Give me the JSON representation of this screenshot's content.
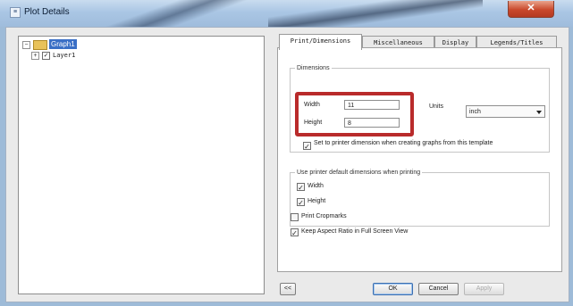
{
  "window": {
    "title": "Plot Details",
    "icon_text": "≡",
    "close_label": "✕"
  },
  "tree": {
    "root": {
      "label": "Graph1",
      "expander": "−"
    },
    "child": {
      "label": "Layer1",
      "expander": "+",
      "checked": "✓"
    }
  },
  "tabs": [
    {
      "label": "Print/Dimensions"
    },
    {
      "label": "Miscellaneous"
    },
    {
      "label": "Display"
    },
    {
      "label": "Legends/Titles"
    }
  ],
  "dimensions": {
    "group_title": "Dimensions",
    "width_label": "Width",
    "width_value": "11",
    "height_label": "Height",
    "height_value": "8",
    "units_label": "Units",
    "units_value": "inch",
    "set_printer_label": "Set to printer dimension when creating graphs from this template",
    "set_printer_checked": "✓"
  },
  "printer_defaults": {
    "group_title": "Use printer default dimensions when printing",
    "width_label": "Width",
    "width_checked": "✓",
    "height_label": "Height",
    "height_checked": "✓"
  },
  "options": {
    "crop_label": "Print Cropmarks",
    "crop_checked": "",
    "aspect_label": "Keep Aspect Ratio in Full Screen View",
    "aspect_checked": "✓"
  },
  "buttons": {
    "collapse": "<<",
    "ok": "OK",
    "cancel": "Cancel",
    "apply": "Apply"
  }
}
